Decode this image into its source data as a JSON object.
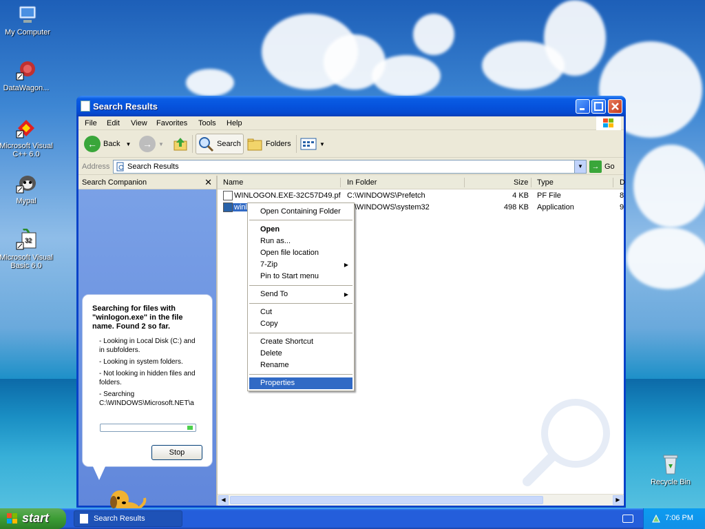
{
  "desktop": {
    "icons": [
      {
        "label": "My Computer"
      },
      {
        "label": "DataWagon..."
      },
      {
        "label": "Microsoft Visual C++ 6.0"
      },
      {
        "label": "Mypal"
      },
      {
        "label": "Microsoft Visual Basic 6.0"
      },
      {
        "label": "Recycle Bin"
      }
    ]
  },
  "window": {
    "title": "Search Results",
    "menu": [
      "File",
      "Edit",
      "View",
      "Favorites",
      "Tools",
      "Help"
    ],
    "toolbar": {
      "back": "Back",
      "search": "Search",
      "folders": "Folders"
    },
    "address": {
      "label": "Address",
      "value": "Search Results",
      "go": "Go"
    },
    "companion": {
      "title": "Search Companion",
      "heading": "Searching for files with \"winlogon.exe\" in the file name.  Found 2 so far.",
      "items": [
        "- Looking in Local Disk (C:) and in subfolders.",
        "- Looking in system folders.",
        "- Not looking in hidden files and folders.",
        "- Searching C:\\WINDOWS\\Microsoft.NET\\a"
      ],
      "stop": "Stop"
    },
    "columns": [
      "Name",
      "In Folder",
      "Size",
      "Type",
      "D"
    ],
    "rows": [
      {
        "name": "WINLOGON.EXE-32C57D49.pf",
        "folder": "C:\\WINDOWS\\Prefetch",
        "size": "4 KB",
        "type": "PF File",
        "d": "8"
      },
      {
        "name": "winlogon.exe",
        "folder": "C:\\WINDOWS\\system32",
        "size": "498 KB",
        "type": "Application",
        "d": "9"
      }
    ]
  },
  "context_menu": {
    "items": [
      "Open Containing Folder",
      "Open",
      "Run as...",
      "Open file location",
      "7-Zip",
      "Pin to Start menu",
      "Send To",
      "Cut",
      "Copy",
      "Create Shortcut",
      "Delete",
      "Rename",
      "Properties"
    ]
  },
  "taskbar": {
    "start": "start",
    "task": "Search Results",
    "clock": "7:06 PM"
  }
}
